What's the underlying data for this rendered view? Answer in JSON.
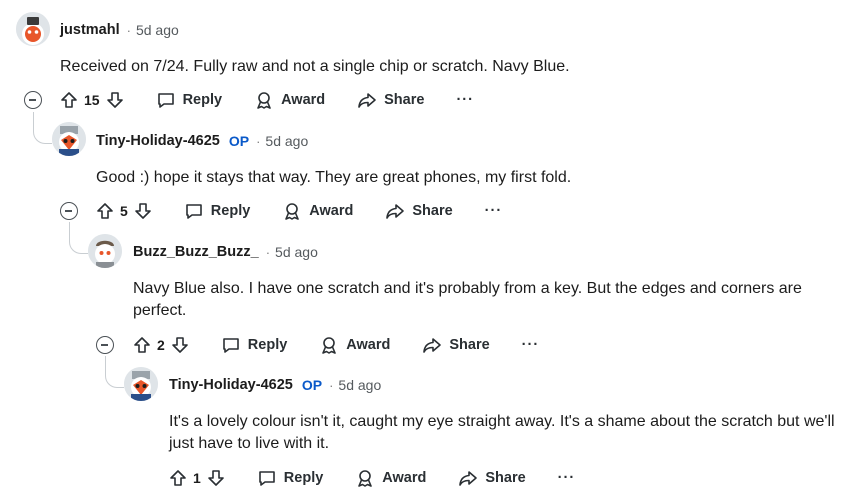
{
  "comments": [
    {
      "author": "justmahl",
      "op_badge": "",
      "time": "5d ago",
      "body": "Received on 7/24. Fully raw and not a single chip or scratch. Navy Blue.",
      "votes": "15",
      "reply_label": "Reply",
      "award_label": "Award",
      "share_label": "Share",
      "more_label": "···"
    },
    {
      "author": "Tiny-Holiday-4625",
      "op_badge": "OP",
      "time": "5d ago",
      "body": "Good :) hope it stays that way. They are great phones, my first fold.",
      "votes": "5",
      "reply_label": "Reply",
      "award_label": "Award",
      "share_label": "Share",
      "more_label": "···"
    },
    {
      "author": "Buzz_Buzz_Buzz_",
      "op_badge": "",
      "time": "5d ago",
      "body": "Navy Blue also. I have one scratch and it's probably from a key. But the edges and corners are perfect.",
      "votes": "2",
      "reply_label": "Reply",
      "award_label": "Award",
      "share_label": "Share",
      "more_label": "···"
    },
    {
      "author": "Tiny-Holiday-4625",
      "op_badge": "OP",
      "time": "5d ago",
      "body": "It's a lovely colour isn't it, caught my eye straight away. It's a shame about the scratch but we'll just have to live with it.",
      "votes": "1",
      "reply_label": "Reply",
      "award_label": "Award",
      "share_label": "Share",
      "more_label": "···"
    }
  ],
  "colors": {
    "text": "#1c1c1c",
    "op": "#0a59c9",
    "meta": "#555a5e",
    "thread": "#c9ced2"
  },
  "icons": [
    "collapse-icon",
    "upvote-icon",
    "downvote-icon",
    "reply-icon",
    "award-icon",
    "share-icon",
    "more-icon"
  ]
}
